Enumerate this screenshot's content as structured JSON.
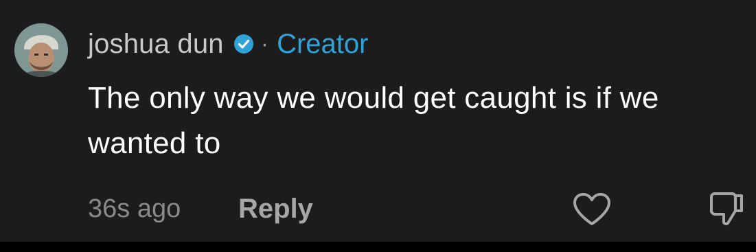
{
  "comment": {
    "author": "joshua dun",
    "separator": "·",
    "badge_label": "Creator",
    "text": "The only way we would get caught is if we wanted to",
    "timestamp": "36s ago",
    "reply_label": "Reply",
    "icons": {
      "avatar": "profile-photo",
      "verified": "verified-check-icon",
      "like": "heart-outline-icon",
      "dislike": "thumbs-down-outline-icon"
    },
    "colors": {
      "background": "#1c1c1c",
      "creator_accent": "#2fa3d8",
      "verified_badge": "#2fa3d8"
    }
  }
}
